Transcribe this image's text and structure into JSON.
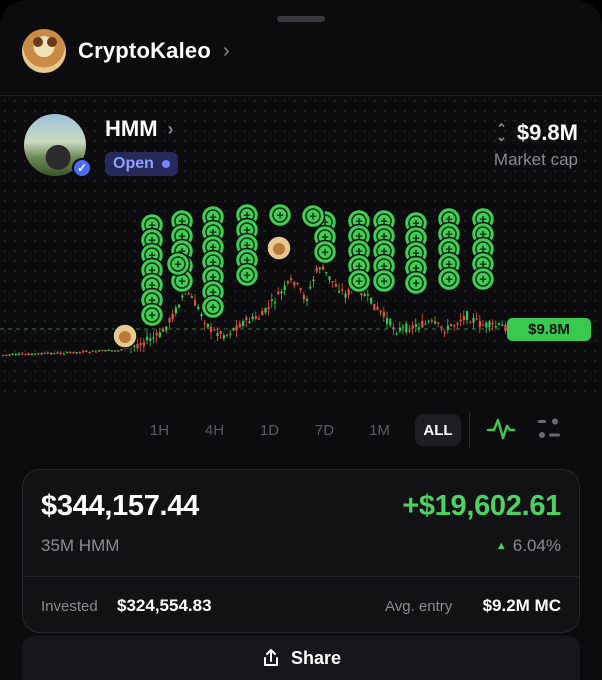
{
  "profile": {
    "name": "CryptoKaleo"
  },
  "token": {
    "name": "HMM",
    "status": "Open",
    "market_cap_value": "$9.8M",
    "market_cap_label": "Market cap"
  },
  "chart": {
    "current_price_label": "$9.8M",
    "buy_marker_symbol": "+"
  },
  "timeframes": [
    "1H",
    "4H",
    "1D",
    "7D",
    "1M",
    "ALL"
  ],
  "active_timeframe": "ALL",
  "position": {
    "value": "$344,157.44",
    "pnl": "+$19,602.61",
    "amount": "35M HMM",
    "pct": "6.04%",
    "invested_label": "Invested",
    "invested_value": "$324,554.83",
    "avg_label": "Avg. entry",
    "avg_value": "$9.2M MC"
  },
  "share": {
    "label": "Share"
  },
  "colors": {
    "accent_green": "#39c94f",
    "candle_red": "#e5533d",
    "badge_blue": "#8fa0ff"
  }
}
